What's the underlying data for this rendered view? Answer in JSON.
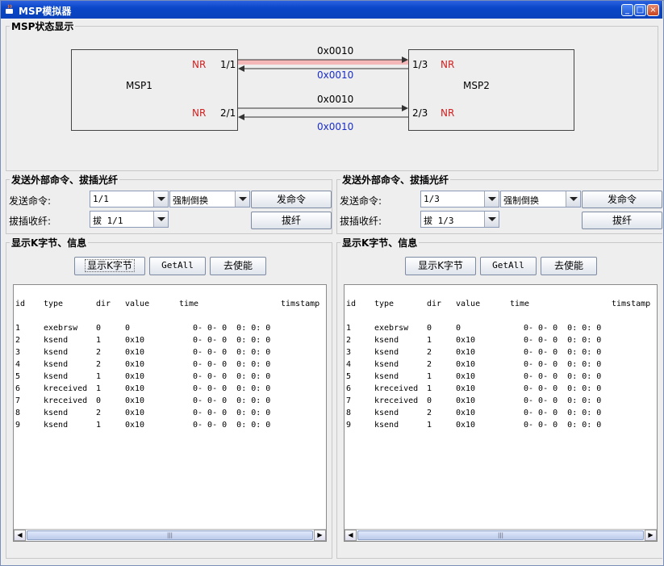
{
  "window": {
    "title": "MSP模拟器",
    "min": "_",
    "max": "□",
    "close": "×"
  },
  "status_group": {
    "title": "MSP状态显示",
    "msp1": {
      "name": "MSP1",
      "port1": "1/1",
      "port2": "2/1",
      "nr1": "NR",
      "nr2": "NR"
    },
    "msp2": {
      "name": "MSP2",
      "port1": "1/3",
      "port2": "2/3",
      "nr1": "NR",
      "nr2": "NR"
    },
    "link1_top": "0x0010",
    "link1_bottom": "0x0010",
    "link2_top": "0x0010",
    "link2_bottom": "0x0010"
  },
  "left": {
    "cmd_title": "发送外部命令、拔插光纤",
    "send_label": "发送命令:",
    "port_value": "1/1",
    "cmd_value": "强制倒换",
    "send_button": "发命令",
    "plug_label": "拔插收纤:",
    "plug_value": "拔 1/1",
    "plug_button": "拔纤",
    "info_title": "显示K字节、信息",
    "btn_show": "显示K字节",
    "btn_getall": "GetAll",
    "btn_disable": "去使能"
  },
  "right": {
    "cmd_title": "发送外部命令、拔插光纤",
    "send_label": "发送命令:",
    "port_value": "1/3",
    "cmd_value": "强制倒换",
    "send_button": "发命令",
    "plug_label": "拔插收纤:",
    "plug_value": "拔 1/3",
    "plug_button": "拔纤",
    "info_title": "显示K字节、信息",
    "btn_show": "显示K字节",
    "btn_getall": "GetAll",
    "btn_disable": "去使能"
  },
  "table": {
    "headers": {
      "id": "id",
      "type": "type",
      "dir": "dir",
      "value": "value",
      "time": "time",
      "timstamp": "timstamp"
    },
    "rows": [
      {
        "id": "1",
        "type": "exebrsw",
        "dir": "0",
        "value": "0",
        "time": "0- 0- 0  0: 0: 0"
      },
      {
        "id": "2",
        "type": "ksend",
        "dir": "1",
        "value": "0x10",
        "time": "0- 0- 0  0: 0: 0"
      },
      {
        "id": "3",
        "type": "ksend",
        "dir": "2",
        "value": "0x10",
        "time": "0- 0- 0  0: 0: 0"
      },
      {
        "id": "4",
        "type": "ksend",
        "dir": "2",
        "value": "0x10",
        "time": "0- 0- 0  0: 0: 0"
      },
      {
        "id": "5",
        "type": "ksend",
        "dir": "1",
        "value": "0x10",
        "time": "0- 0- 0  0: 0: 0"
      },
      {
        "id": "6",
        "type": "kreceived",
        "dir": "1",
        "value": "0x10",
        "time": "0- 0- 0  0: 0: 0"
      },
      {
        "id": "7",
        "type": "kreceived",
        "dir": "0",
        "value": "0x10",
        "time": "0- 0- 0  0: 0: 0"
      },
      {
        "id": "8",
        "type": "ksend",
        "dir": "2",
        "value": "0x10",
        "time": "0- 0- 0  0: 0: 0"
      },
      {
        "id": "9",
        "type": "ksend",
        "dir": "1",
        "value": "0x10",
        "time": "0- 0- 0  0: 0: 0"
      }
    ]
  },
  "colors": {
    "nr": "#d02020",
    "link_blue": "#1a2ec8",
    "titlebar": "#0a46c8",
    "active_link": "#f4b8b8"
  }
}
